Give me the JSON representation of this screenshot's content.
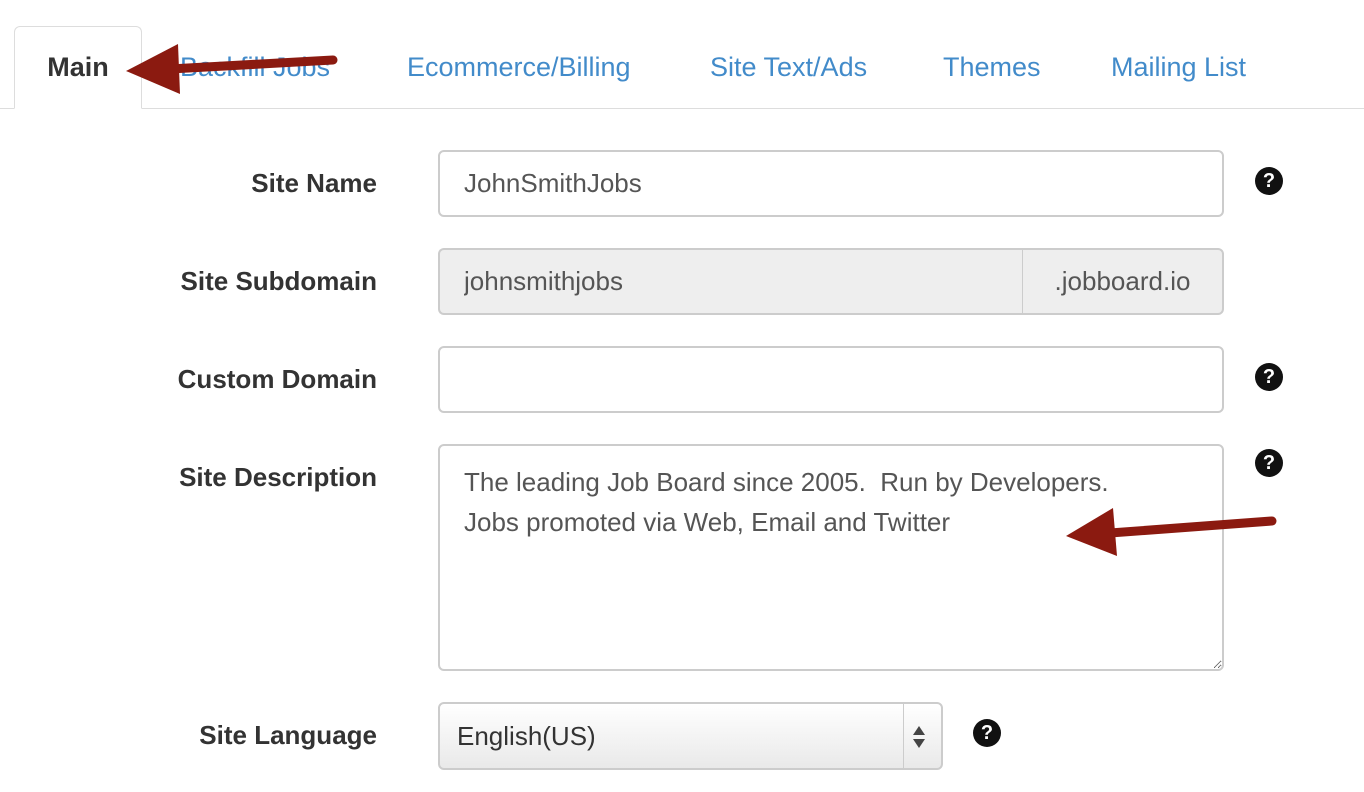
{
  "tabs": [
    {
      "label": "Main",
      "active": true
    },
    {
      "label": "Backfill Jobs",
      "active": false
    },
    {
      "label": "Ecommerce/Billing",
      "active": false
    },
    {
      "label": "Site Text/Ads",
      "active": false
    },
    {
      "label": "Themes",
      "active": false
    },
    {
      "label": "Mailing List",
      "active": false
    }
  ],
  "form": {
    "site_name": {
      "label": "Site Name",
      "value": "JohnSmithJobs"
    },
    "site_subdomain": {
      "label": "Site Subdomain",
      "value": "johnsmithjobs",
      "suffix": ".jobboard.io"
    },
    "custom_domain": {
      "label": "Custom Domain",
      "value": ""
    },
    "site_description": {
      "label": "Site Description",
      "value": "The leading Job Board since 2005.  Run by Developers.\nJobs promoted via Web, Email and Twitter"
    },
    "site_language": {
      "label": "Site Language",
      "value": "English(US)"
    }
  },
  "help_glyph": "?",
  "icons": {
    "help": "question-circle-icon",
    "select_arrows": "up-down-caret-icon",
    "annotation": "red-arrow-icon"
  },
  "colors": {
    "link": "#428bca",
    "annotation_arrow": "#8b1a10",
    "help_icon": "#111111"
  }
}
